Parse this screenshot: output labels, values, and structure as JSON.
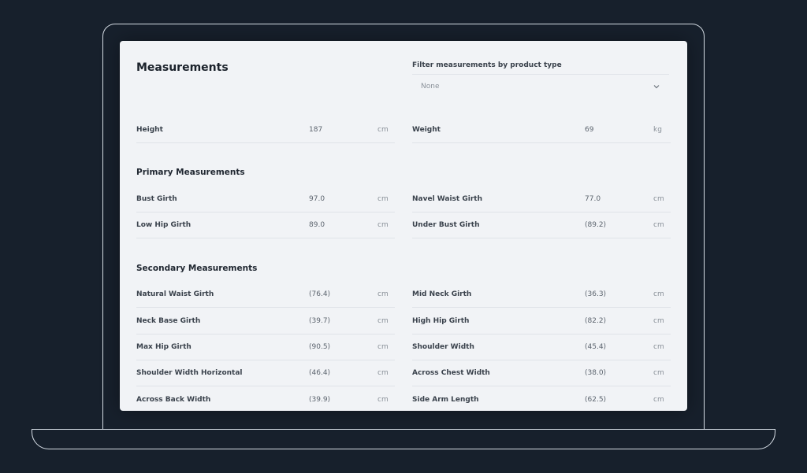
{
  "title": "Measurements",
  "filter": {
    "label": "Filter measurements by product type",
    "value": "None",
    "icon": "chevron-down-icon"
  },
  "basic": [
    {
      "label": "Height",
      "value": "187",
      "unit": "cm"
    },
    {
      "label": "Weight",
      "value": "69",
      "unit": "kg"
    }
  ],
  "primary": {
    "title": "Primary Measurements",
    "rows": [
      {
        "label": "Bust Girth",
        "value": "97.0",
        "unit": "cm"
      },
      {
        "label": "Navel Waist Girth",
        "value": "77.0",
        "unit": "cm"
      },
      {
        "label": "Low Hip Girth",
        "value": "89.0",
        "unit": "cm"
      },
      {
        "label": "Under Bust Girth",
        "value": "(89.2)",
        "unit": "cm"
      }
    ]
  },
  "secondary": {
    "title": "Secondary Measurements",
    "rows": [
      {
        "label": "Natural Waist Girth",
        "value": "(76.4)",
        "unit": "cm"
      },
      {
        "label": "Mid Neck Girth",
        "value": "(36.3)",
        "unit": "cm"
      },
      {
        "label": "Neck Base Girth",
        "value": "(39.7)",
        "unit": "cm"
      },
      {
        "label": "High Hip Girth",
        "value": "(82.2)",
        "unit": "cm"
      },
      {
        "label": "Max Hip Girth",
        "value": "(90.5)",
        "unit": "cm"
      },
      {
        "label": "Shoulder Width",
        "value": "(45.4)",
        "unit": "cm"
      },
      {
        "label": "Shoulder Width Horizontal",
        "value": "(46.4)",
        "unit": "cm"
      },
      {
        "label": "Across Chest Width",
        "value": "(38.0)",
        "unit": "cm"
      },
      {
        "label": "Across Back Width",
        "value": "(39.9)",
        "unit": "cm"
      },
      {
        "label": "Side Arm Length",
        "value": "(62.5)",
        "unit": "cm"
      }
    ]
  }
}
